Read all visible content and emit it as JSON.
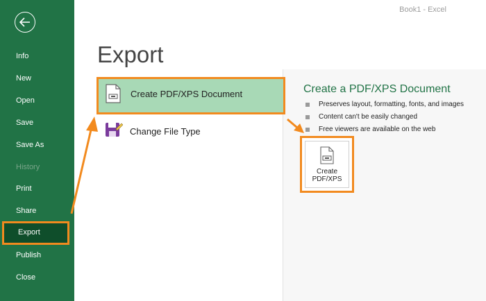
{
  "window": {
    "title": "Book1 - Excel"
  },
  "sidebar": {
    "back_label": "Back",
    "items": [
      {
        "label": "Info",
        "state": "normal"
      },
      {
        "label": "New",
        "state": "normal"
      },
      {
        "label": "Open",
        "state": "normal"
      },
      {
        "label": "Save",
        "state": "normal"
      },
      {
        "label": "Save As",
        "state": "normal"
      },
      {
        "label": "History",
        "state": "disabled"
      },
      {
        "label": "Print",
        "state": "normal"
      },
      {
        "label": "Share",
        "state": "normal"
      },
      {
        "label": "Export",
        "state": "active"
      },
      {
        "label": "Publish",
        "state": "normal"
      },
      {
        "label": "Close",
        "state": "normal"
      }
    ]
  },
  "main": {
    "title": "Export",
    "options": [
      {
        "label": "Create PDF/XPS Document",
        "icon": "pdf-document-icon",
        "selected": true
      },
      {
        "label": "Change File Type",
        "icon": "change-file-type-icon",
        "selected": false
      }
    ]
  },
  "panel": {
    "heading": "Create a PDF/XPS Document",
    "bullets": [
      "Preserves layout, formatting, fonts, and images",
      "Content can't be easily changed",
      "Free viewers are available on the web"
    ],
    "button": {
      "line1": "Create",
      "line2": "PDF/XPS",
      "icon": "pdf-document-icon"
    }
  },
  "colors": {
    "sidebar": "#217346",
    "active": "#0f4e2b",
    "highlight": "#f28a1e",
    "selected_bg": "#a8d9b6"
  }
}
